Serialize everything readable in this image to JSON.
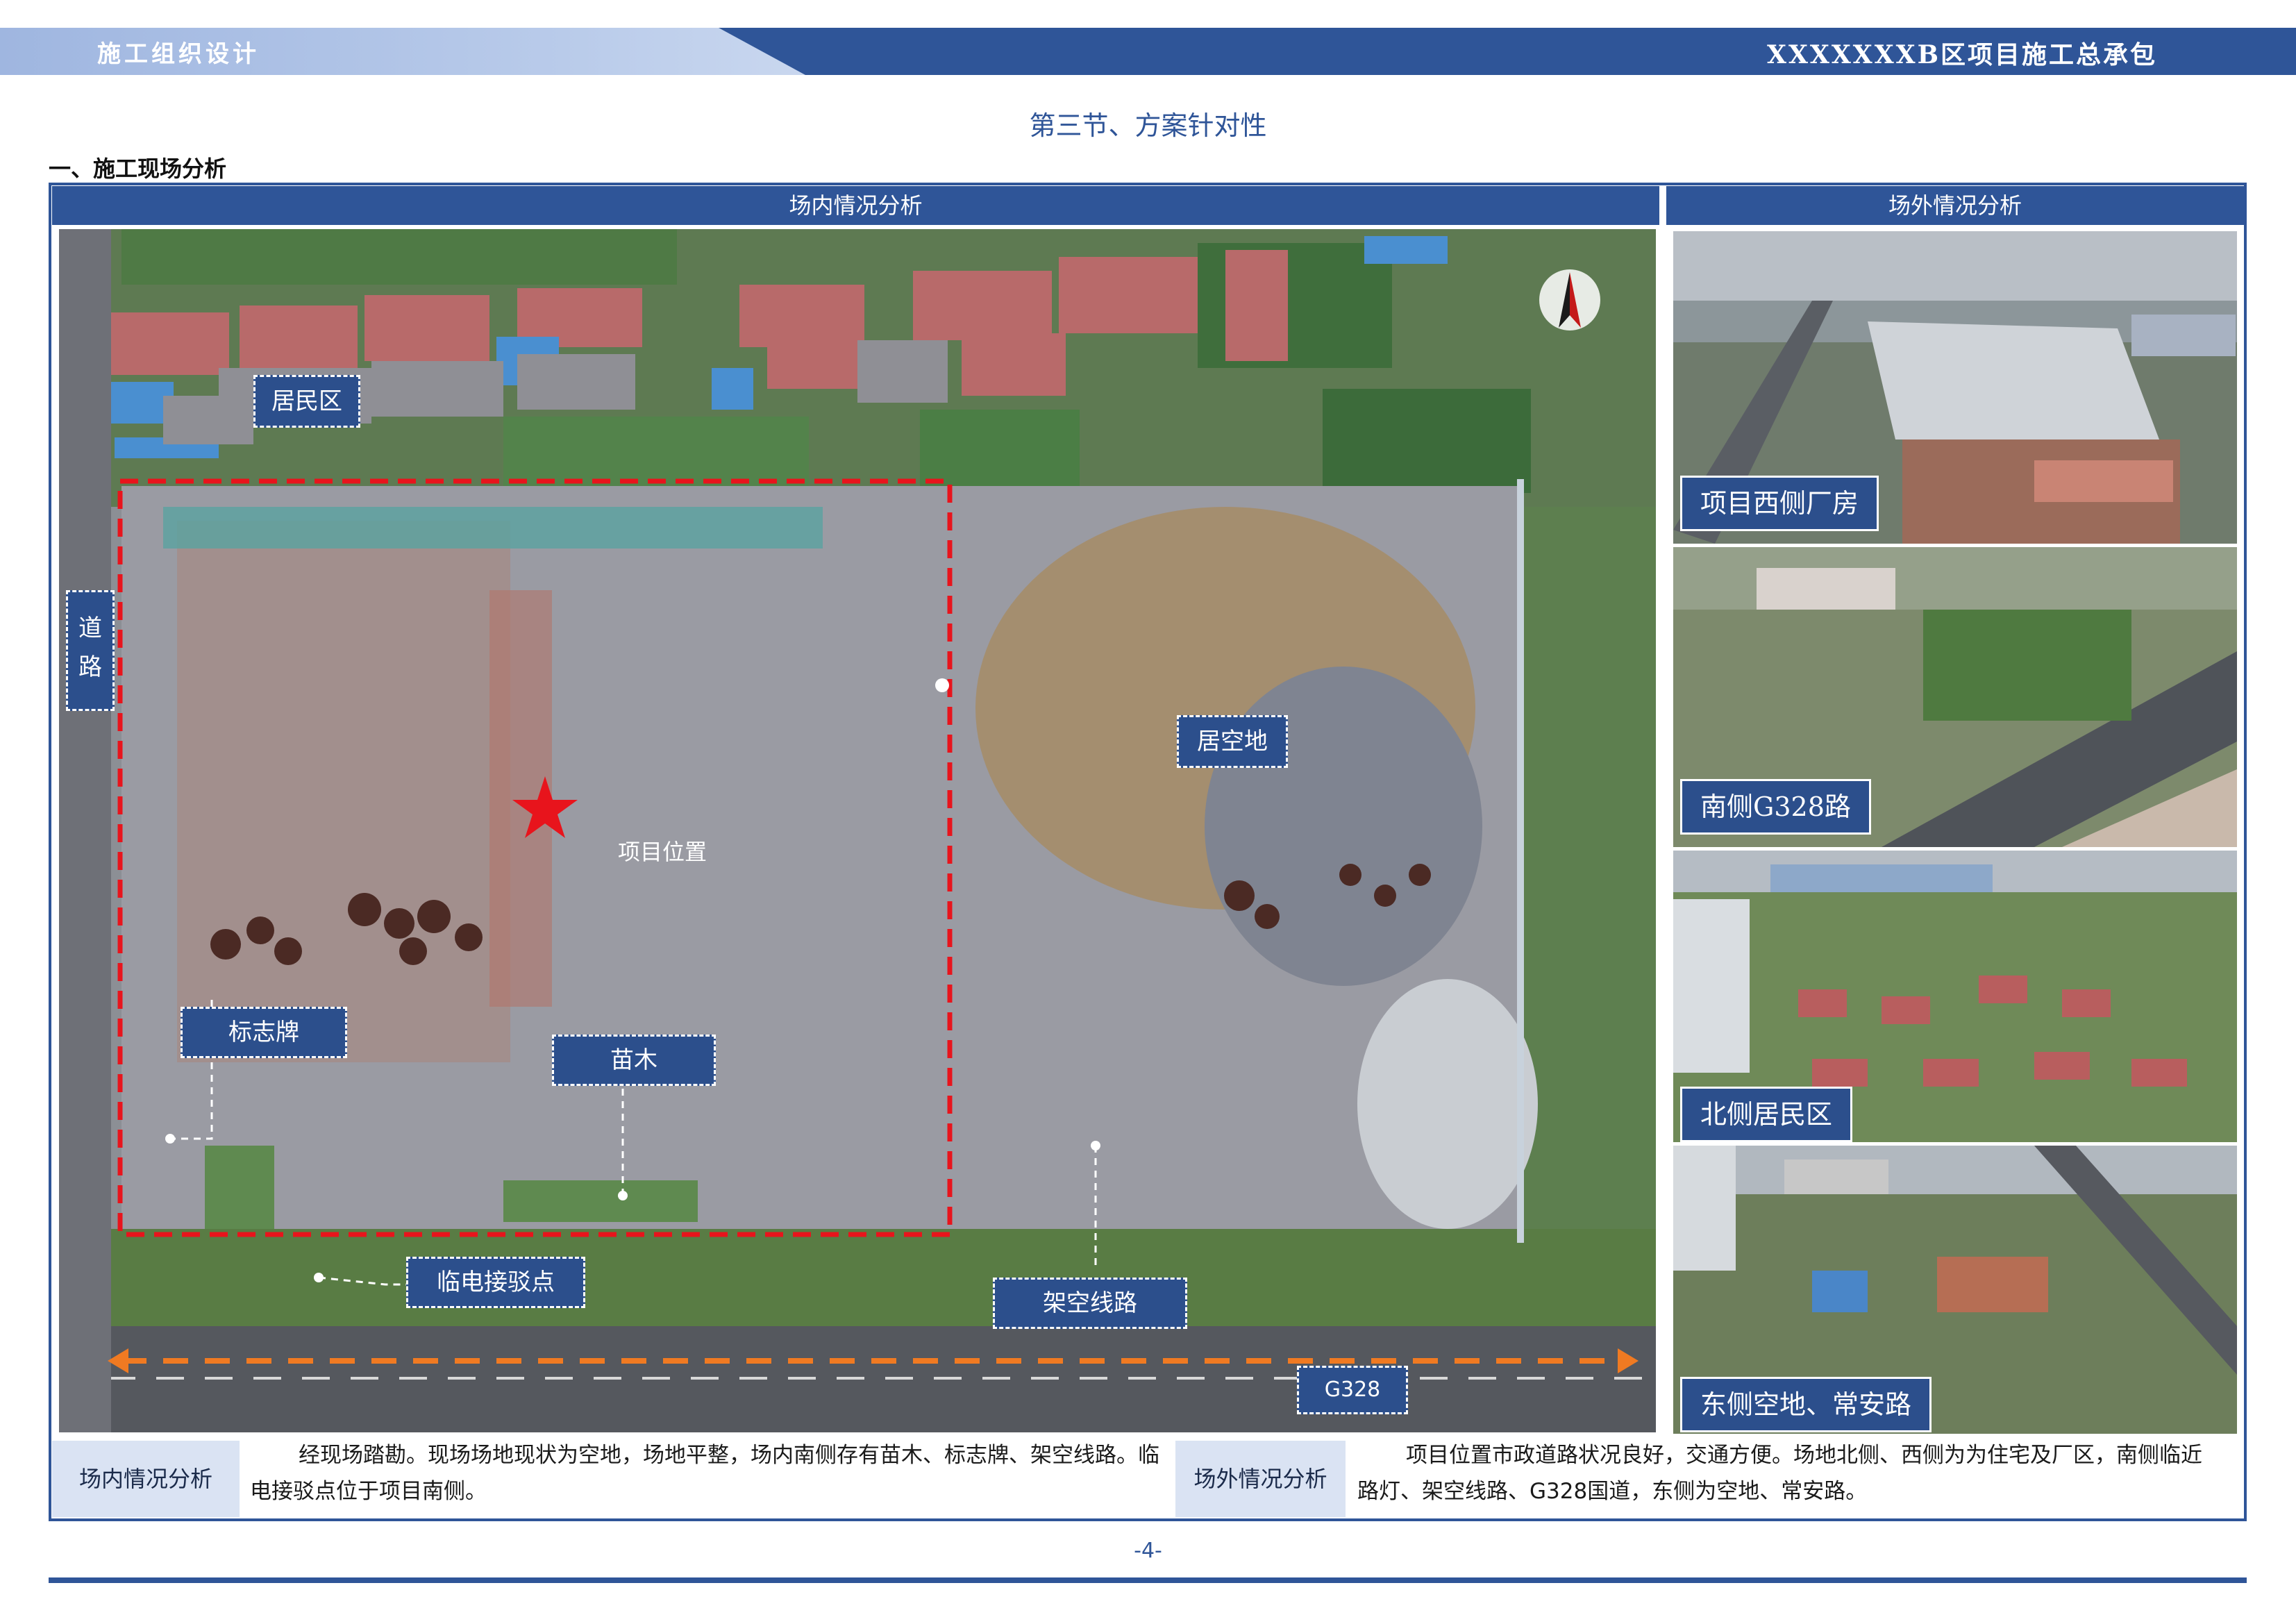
{
  "header": {
    "left_title": "施工组织设计",
    "right_title": "XXXXXXXB区项目施工总承包"
  },
  "section_title": "第三节、方案针对性",
  "sub_heading": "一、施工现场分析",
  "panels": {
    "inside_header": "场内情况分析",
    "outside_header": "场外情况分析"
  },
  "map": {
    "labels": {
      "residential": "居民区",
      "road": "道路",
      "vacant": "居空地",
      "project_location": "项目位置",
      "sign": "标志牌",
      "seedlings": "苗木",
      "power_point": "临电接驳点",
      "overhead_line": "架空线路",
      "g328": "G328"
    },
    "compass": "north-arrow-icon",
    "marker": "red-star-icon"
  },
  "photos": [
    {
      "caption": "项目西侧厂房"
    },
    {
      "caption": "南侧G328路"
    },
    {
      "caption": "北侧居民区"
    },
    {
      "caption": "东侧空地、常安路"
    }
  ],
  "summary": {
    "inside_label": "场内情况分析",
    "inside_text": "经现场踏勘。现场场地现状为空地，场地平整，场内南侧存有苗木、标志牌、架空线路。临电接驳点位于项目南侧。",
    "outside_label": "场外情况分析",
    "outside_text": "项目位置市政道路状况良好，交通方便。场地北侧、西侧为为住宅及厂区，南侧临近路灯、架空线路、G328国道，东侧为空地、常安路。"
  },
  "page_number": "-4-",
  "colors": {
    "primary": "#2f5598",
    "label_bg": "#2c4f8c",
    "summary_label_bg": "#dae3f3",
    "boundary": "#e8141c",
    "arrow": "#f07a22"
  }
}
